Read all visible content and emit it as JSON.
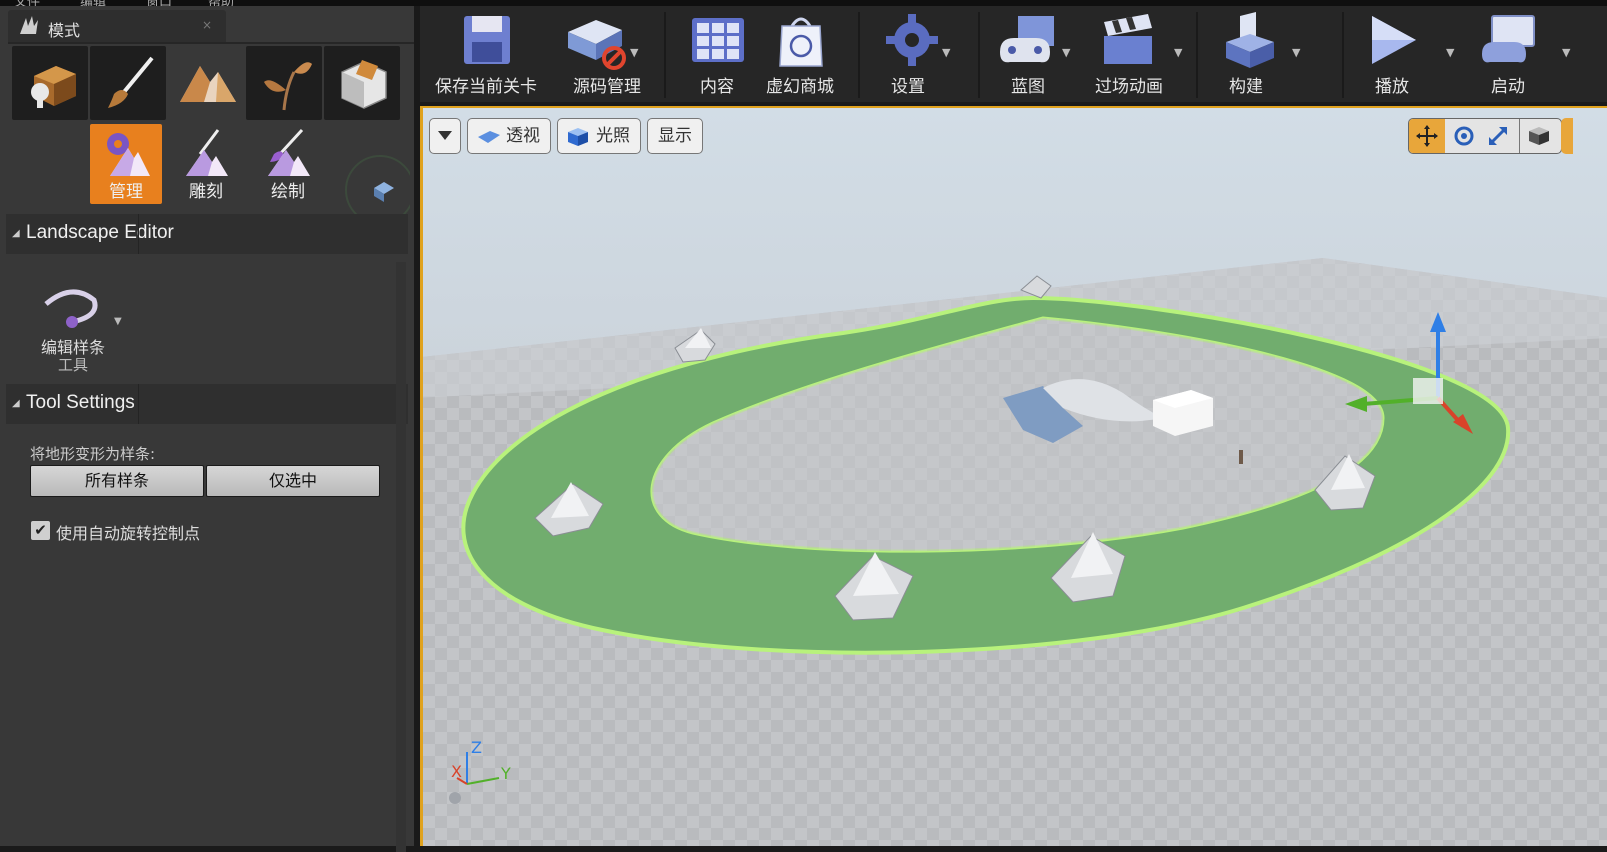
{
  "menu": [
    "文件",
    "编辑",
    "窗口",
    "帮助"
  ],
  "mode_panel": {
    "tab_title": "模式",
    "tab_close": "×",
    "modes": [
      "place-mode",
      "paint-mode",
      "landscape-mode",
      "foliage-mode",
      "geometry-mode"
    ],
    "sub_tools": [
      {
        "label": "管理",
        "active": true
      },
      {
        "label": "雕刻",
        "active": false
      },
      {
        "label": "绘制",
        "active": false
      }
    ]
  },
  "landscape_editor": {
    "title": "Landscape Editor",
    "tool_label_line1": "编辑样条",
    "tool_label_line2": "工具"
  },
  "tool_settings": {
    "title": "Tool Settings",
    "deform_label": "将地形变形为样条:",
    "all_splines_button": "所有样条",
    "selected_only_button": "仅选中",
    "checkbox_checked": true,
    "checkbox_mark": "✔",
    "auto_rotate_label": "使用自动旋转控制点"
  },
  "toolbar": {
    "save": "保存当前关卡",
    "source_control": "源码管理",
    "content": "内容",
    "marketplace": "虚幻商城",
    "settings": "设置",
    "blueprint": "蓝图",
    "cinematics": "过场动画",
    "build": "构建",
    "play": "播放",
    "launch": "启动"
  },
  "viewport": {
    "perspective": "透视",
    "lighting": "光照",
    "show": "显示",
    "axis_z": "Z",
    "axis_x": "X",
    "axis_y": "Y"
  },
  "colors": {
    "accent": "#e8801e",
    "viewport_border": "#e0a21d",
    "spline_road": "#6fab6c",
    "spline_outline": "#b6f07a"
  }
}
